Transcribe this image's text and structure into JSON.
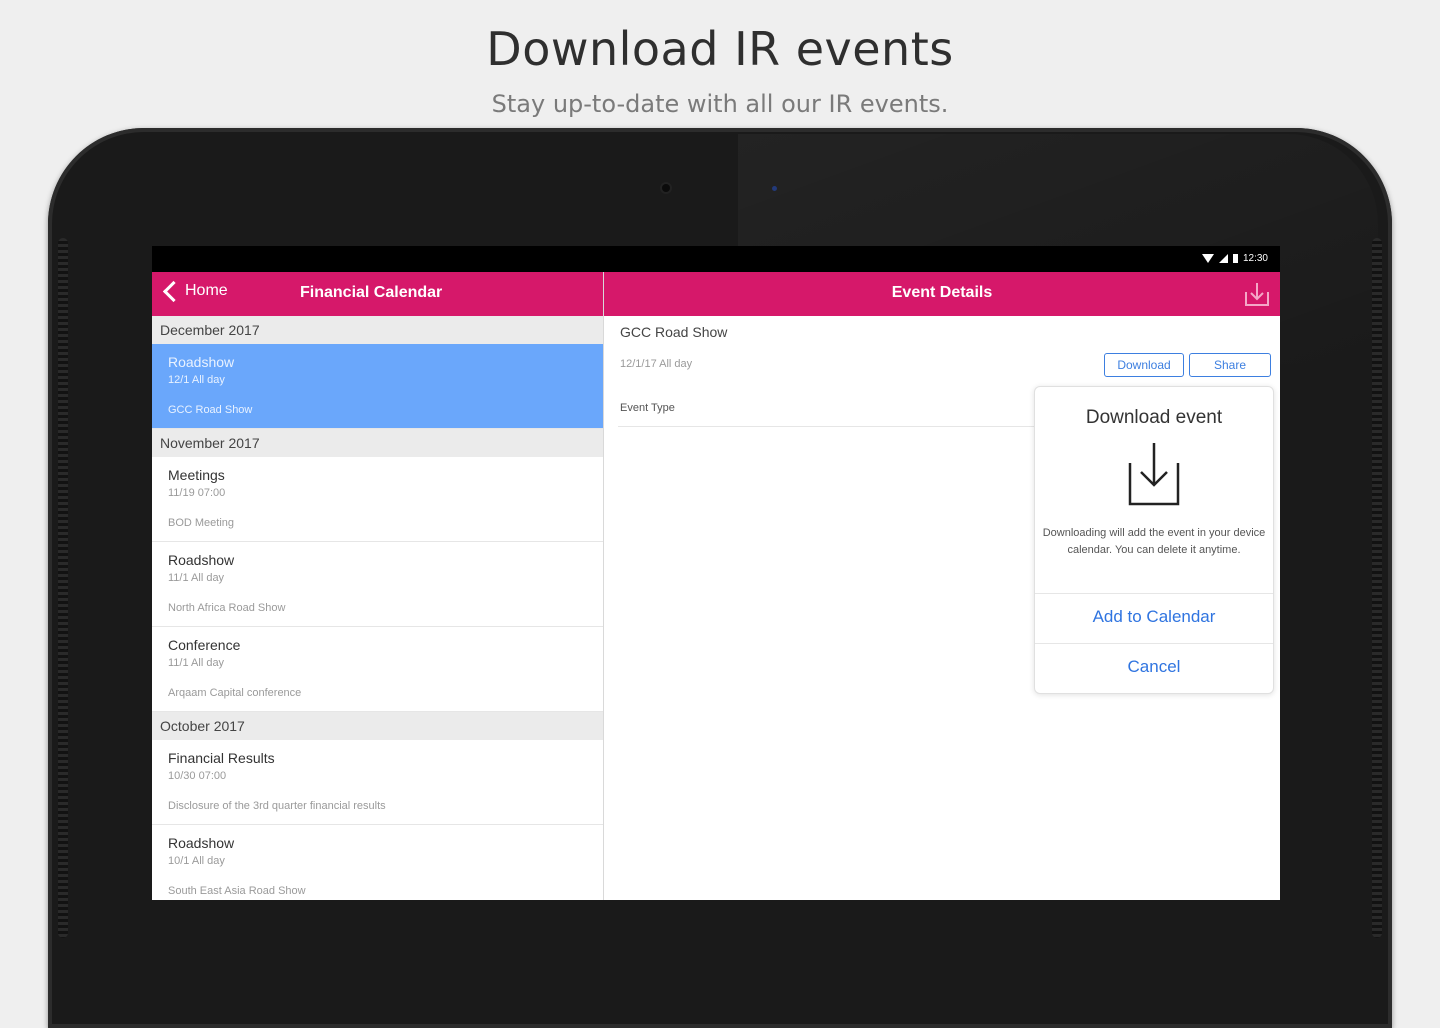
{
  "promo": {
    "headline": "Download IR events",
    "subhead": "Stay up-to-date with all our IR events."
  },
  "status_bar": {
    "time": "12:30"
  },
  "left_panel": {
    "back_label": "Home",
    "title": "Financial Calendar",
    "sections": [
      {
        "header": "December 2017",
        "items": [
          {
            "title": "Roadshow",
            "date": "12/1 All day",
            "subtitle": "GCC Road Show",
            "selected": true
          }
        ]
      },
      {
        "header": "November 2017",
        "items": [
          {
            "title": "Meetings",
            "date": "11/19 07:00",
            "subtitle": "BOD Meeting"
          },
          {
            "title": "Roadshow",
            "date": "11/1 All day",
            "subtitle": "North Africa Road Show"
          },
          {
            "title": "Conference",
            "date": "11/1 All day",
            "subtitle": "Arqaam Capital conference"
          }
        ]
      },
      {
        "header": "October 2017",
        "items": [
          {
            "title": "Financial Results",
            "date": "10/30 07:00",
            "subtitle": "Disclosure of the 3rd quarter financial results"
          },
          {
            "title": "Roadshow",
            "date": "10/1 All day",
            "subtitle": "South East Asia Road Show"
          }
        ]
      }
    ]
  },
  "right_panel": {
    "title": "Event Details",
    "event_name": "GCC Road Show",
    "event_date": "12/1/17 All day",
    "download_label": "Download",
    "share_label": "Share",
    "event_type_label": "Event Type"
  },
  "popup": {
    "title": "Download event",
    "message": "Downloading will add the event in your device calendar. You can delete it anytime.",
    "add_label": "Add to Calendar",
    "cancel_label": "Cancel"
  },
  "colors": {
    "brand": "#d6186a",
    "selected": "#6aa7fb",
    "link": "#2f74e0"
  },
  "icons": [
    "back-chevron-icon",
    "download-icon",
    "wifi-icon",
    "signal-icon",
    "battery-icon"
  ]
}
